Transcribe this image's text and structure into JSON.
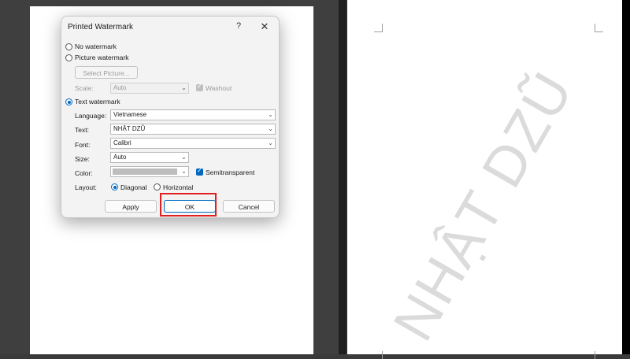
{
  "dialog": {
    "title": "Printed Watermark",
    "help_glyph": "?",
    "close_glyph": "✕",
    "no_watermark": "No watermark",
    "picture_watermark": "Picture watermark",
    "select_picture": "Select Picture...",
    "scale_label": "Scale:",
    "scale_value": "Auto",
    "washout_label": "Washout",
    "text_watermark": "Text watermark",
    "language_label": "Language:",
    "language_value": "Vietnamese",
    "text_label": "Text:",
    "text_value": "NHẬT DZŨ",
    "font_label": "Font:",
    "font_value": "Calibri",
    "size_label": "Size:",
    "size_value": "Auto",
    "color_label": "Color:",
    "semitransparent_label": "Semitransparent",
    "layout_label": "Layout:",
    "diagonal_label": "Diagonal",
    "horizontal_label": "Horizontal",
    "apply_label": "Apply",
    "ok_label": "OK",
    "cancel_label": "Cancel",
    "selected_option": "text_watermark",
    "selected_layout": "diagonal",
    "washout_checked": true,
    "semitransparent_checked": true
  },
  "preview": {
    "watermark_text": "NHẬT DZŨ"
  },
  "colors": {
    "accent": "#0067c0",
    "highlight": "#e02020",
    "watermark": "#d0d0d0"
  }
}
